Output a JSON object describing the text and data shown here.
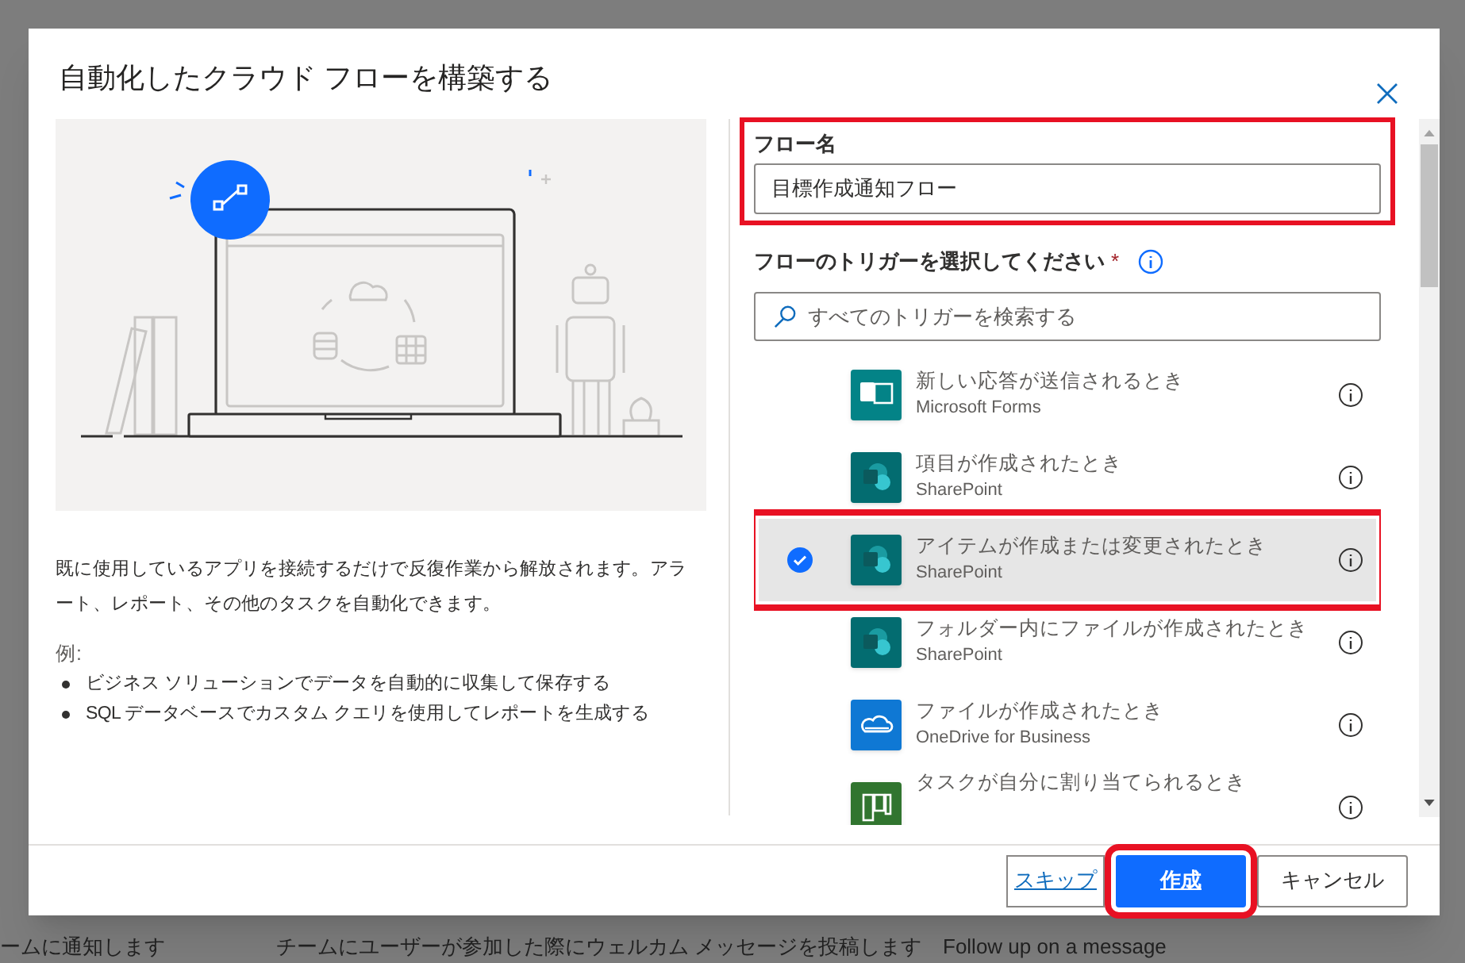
{
  "background": {
    "texts": [
      "ームに通知します",
      "チームにユーザーが参加した際にウェルカム メッセージを投稿します",
      "Follow up on a message"
    ]
  },
  "dialog": {
    "title": "自動化したクラウド フローを構築する",
    "description": "既に使用しているアプリを接続するだけで反復作業から解放されます。アラート、レポート、その他のタスクを自動化できます。",
    "examples_label": "例:",
    "examples": [
      "ビジネス ソリューションでデータを自動的に収集して保存する",
      "SQL データベースでカスタム クエリを使用してレポートを生成する"
    ],
    "flow_name": {
      "label": "フロー名",
      "value": "目標作成通知フロー",
      "highlighted": true
    },
    "trigger": {
      "label": "フローのトリガーを選択してください",
      "required_mark": "*",
      "search_placeholder": "すべてのトリガーを検索する"
    },
    "triggers": [
      {
        "title": "新しい応答が送信されるとき",
        "connector": "Microsoft Forms",
        "kind": "forms",
        "selected": false,
        "highlighted": false
      },
      {
        "title": "項目が作成されたとき",
        "connector": "SharePoint",
        "kind": "sharepoint",
        "selected": false,
        "highlighted": false
      },
      {
        "title": "アイテムが作成または変更されたとき",
        "connector": "SharePoint",
        "kind": "sharepoint",
        "selected": true,
        "highlighted": true
      },
      {
        "title": "フォルダー内にファイルが作成されたとき",
        "connector": "SharePoint",
        "kind": "sharepoint",
        "selected": false,
        "highlighted": false
      },
      {
        "title": "ファイルが作成されたとき",
        "connector": "OneDrive for Business",
        "kind": "onedrive",
        "selected": false,
        "highlighted": false
      },
      {
        "title": "タスクが自分に割り当てられるとき",
        "kind": "planner",
        "selected": false,
        "highlighted": false
      }
    ],
    "buttons": [
      {
        "label": "スキップ",
        "kind": "link",
        "highlighted": false
      },
      {
        "label": "作成",
        "kind": "primary",
        "highlighted": true
      },
      {
        "label": "キャンセル",
        "kind": "secondary",
        "highlighted": false
      }
    ]
  }
}
